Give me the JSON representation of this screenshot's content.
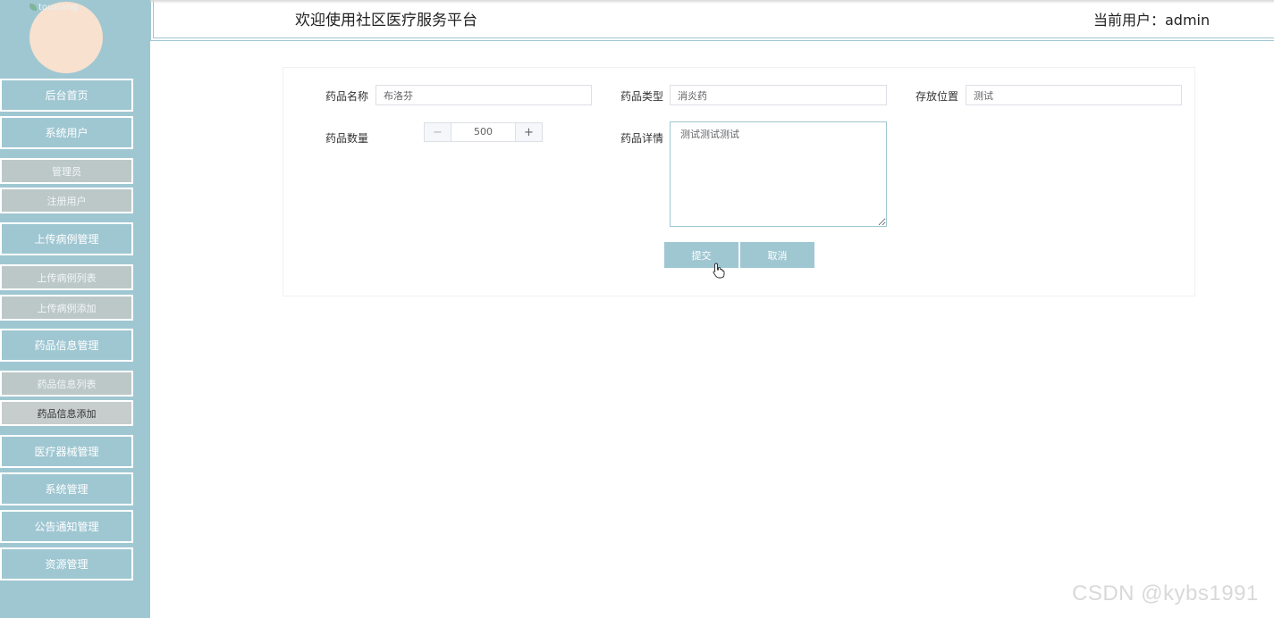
{
  "sidebar": {
    "avatar_alt": "touxiang",
    "items": [
      {
        "label": "后台首页",
        "type": "big"
      },
      {
        "label": "系统用户",
        "type": "big"
      },
      {
        "label": "管理员",
        "type": "sub"
      },
      {
        "label": "注册用户",
        "type": "sub"
      },
      {
        "label": "上传病例管理",
        "type": "big"
      },
      {
        "label": "上传病例列表",
        "type": "sub"
      },
      {
        "label": "上传病例添加",
        "type": "sub"
      },
      {
        "label": "药品信息管理",
        "type": "big"
      },
      {
        "label": "药品信息列表",
        "type": "sub"
      },
      {
        "label": "药品信息添加",
        "type": "sub",
        "active": true
      },
      {
        "label": "医疗器械管理",
        "type": "big"
      },
      {
        "label": "系统管理",
        "type": "big"
      },
      {
        "label": "公告通知管理",
        "type": "big"
      },
      {
        "label": "资源管理",
        "type": "big"
      }
    ]
  },
  "header": {
    "title": "欢迎使用社区医疗服务平台",
    "user_label": "当前用户：admin"
  },
  "form": {
    "drug_name_label": "药品名称",
    "drug_name_value": "布洛芬",
    "drug_type_label": "药品类型",
    "drug_type_value": "消炎药",
    "storage_label": "存放位置",
    "storage_value": "测试",
    "quantity_label": "药品数量",
    "quantity_value": "500",
    "minus_symbol": "−",
    "plus_symbol": "+",
    "detail_label": "药品详情",
    "detail_value": "测试测试测试",
    "submit_label": "提交",
    "cancel_label": "取消"
  },
  "watermark": "CSDN @kybs1991",
  "colors": {
    "sidebar_bg": "#9fc7d2",
    "sub_item_bg": "#bcc8c8",
    "button_bg": "#9fc7d2"
  }
}
